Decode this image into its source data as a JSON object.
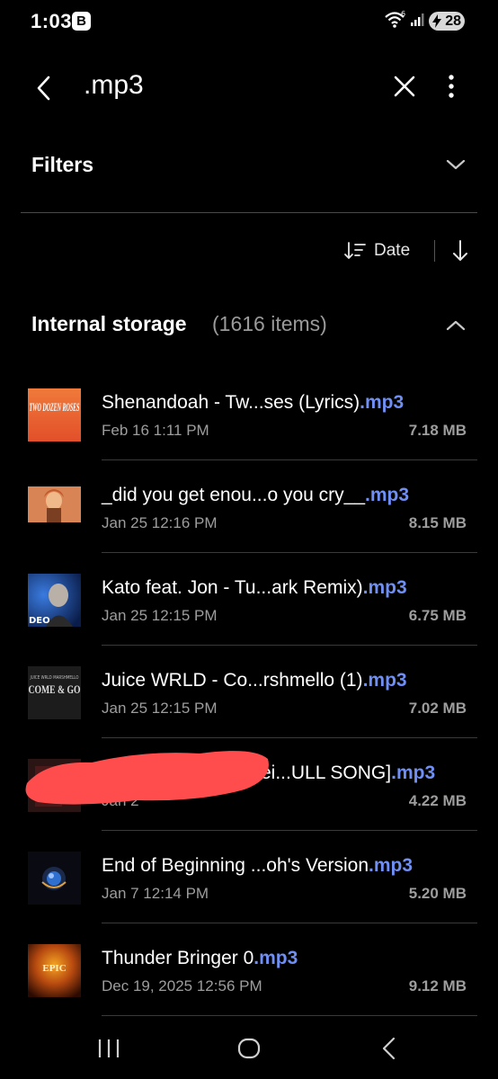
{
  "status": {
    "time": "1:03",
    "badge": "B",
    "battery": "28"
  },
  "appbar": {
    "query": ".mp3"
  },
  "filters": {
    "label": "Filters"
  },
  "sort": {
    "label": "Date"
  },
  "section": {
    "title": "Internal storage",
    "count": "(1616 items)"
  },
  "files": [
    {
      "name": "Shenandoah - Tw...ses (Lyrics)",
      "ext": ".mp3",
      "date": "Feb 16 1:11 PM",
      "size": "7.18 MB",
      "thumb_text": "TWO DOZEN ROSES"
    },
    {
      "name": "_did you get enou...o you cry__",
      "ext": ".mp3",
      "date": "Jan 25 12:16 PM",
      "size": "8.15 MB"
    },
    {
      "name": "Kato feat. Jon - Tu...ark Remix)",
      "ext": ".mp3",
      "date": "Jan 25 12:15 PM",
      "size": "6.75 MB",
      "thumb_text": "DEO"
    },
    {
      "name": "Juice WRLD - Co...rshmello (1)",
      "ext": ".mp3",
      "date": "Jan 25 12:15 PM",
      "size": "7.02 MB",
      "thumb_text": "COME & GO",
      "thumb_small": "JUICE WRLD MARSHMELLO"
    },
    {
      "name": "ei...ULL SONG]",
      "ext": ".mp3",
      "date": "Jan 2",
      "size": "4.22 MB"
    },
    {
      "name": "End of Beginning ...oh's Version",
      "ext": ".mp3",
      "date": "Jan 7 12:14 PM",
      "size": "5.20 MB"
    },
    {
      "name": "Thunder Bringer 0",
      "ext": ".mp3",
      "date": "Dec 19, 2025 12:56 PM",
      "size": "9.12 MB",
      "thumb_text": "EPIC"
    }
  ],
  "colors": {
    "accent": "#6f8ff5",
    "background": "#000000",
    "secondary_text": "#9d9d9d",
    "redaction": "#ff4d4d"
  }
}
